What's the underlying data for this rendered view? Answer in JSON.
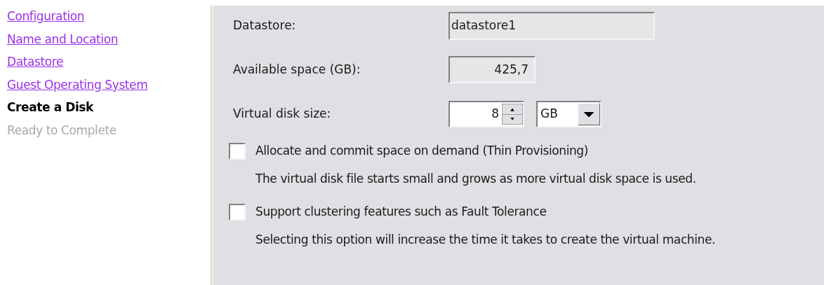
{
  "steps": [
    {
      "label": "Configuration",
      "kind": "link"
    },
    {
      "label": "Name and Location",
      "kind": "link"
    },
    {
      "label": "Datastore",
      "kind": "link"
    },
    {
      "label": "Guest Operating System",
      "kind": "link"
    },
    {
      "label": "Create a Disk",
      "kind": "current"
    },
    {
      "label": "Ready to Complete",
      "kind": "pending"
    }
  ],
  "datastore": {
    "label": "Datastore:",
    "value": "datastore1"
  },
  "available": {
    "label": "Available space (GB):",
    "value": "425,7"
  },
  "disk_size": {
    "label": "Virtual disk size:",
    "value": "8",
    "unit": "GB"
  },
  "options": [
    {
      "label": "Allocate and commit space on demand (Thin Provisioning)",
      "description": "The virtual disk file starts small and grows as more virtual disk space is used.",
      "checked": false
    },
    {
      "label": "Support clustering features such as Fault Tolerance",
      "description": "Selecting this option will increase the time it takes to create the virtual machine.",
      "checked": false
    }
  ]
}
